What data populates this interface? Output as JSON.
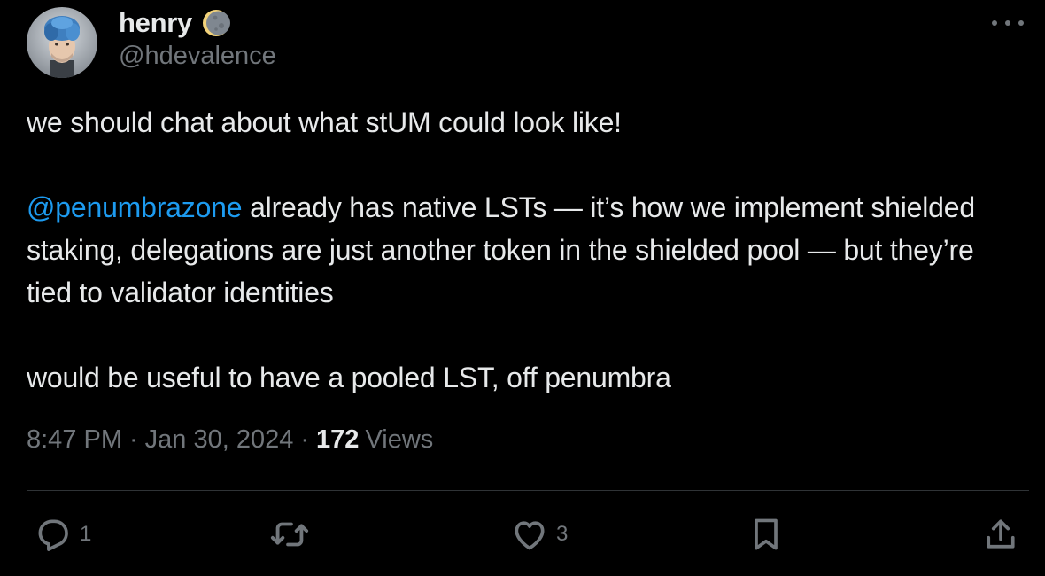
{
  "author": {
    "display_name": "henry",
    "handle": "@hdevalence",
    "badge_icon": "moon-icon",
    "avatar_icon": "profile-photo"
  },
  "tweet": {
    "line1": "we should chat about what stUM could look like!",
    "mention": "@penumbrazone",
    "para2_rest": " already has native LSTs — it’s how we implement shielded staking, delegations are just another token in the shielded pool — but they’re tied to validator identities",
    "line3": "would be useful to have a pooled LST, off penumbra"
  },
  "meta": {
    "time": "8:47 PM",
    "separator": "·",
    "date": "Jan 30, 2024",
    "views_count": "172",
    "views_label": "Views"
  },
  "actions": {
    "reply_count": "1",
    "like_count": "3",
    "icons": [
      "reply-icon",
      "retweet-icon",
      "like-icon",
      "bookmark-icon",
      "share-icon"
    ]
  },
  "colors": {
    "background": "#000000",
    "text": "#e7e9ea",
    "secondary": "#71767b",
    "accent": "#1d9bf0",
    "divider": "#2f3336"
  }
}
